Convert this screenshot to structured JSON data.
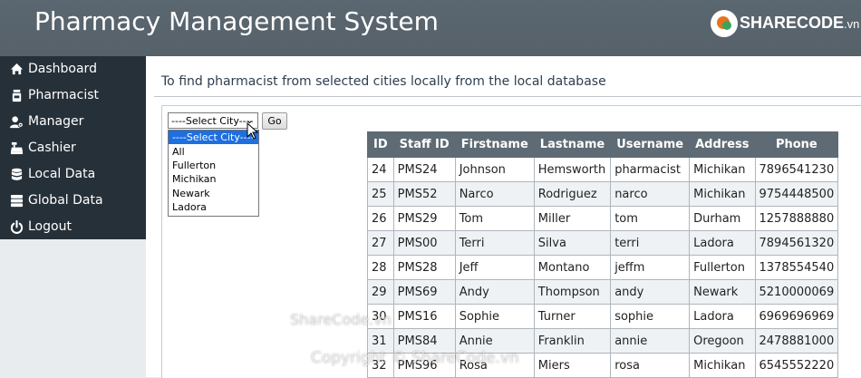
{
  "header": {
    "title": "Pharmacy Management System",
    "brand": {
      "name": "SHARECODE",
      "domain": ".vn"
    }
  },
  "sidebar": {
    "items": [
      {
        "label": "Dashboard",
        "icon": "home-icon"
      },
      {
        "label": "Pharmacist",
        "icon": "pill-bottle-icon"
      },
      {
        "label": "Manager",
        "icon": "user-gear-icon"
      },
      {
        "label": "Cashier",
        "icon": "cash-register-icon"
      },
      {
        "label": "Local Data",
        "icon": "database-icon"
      },
      {
        "label": "Global Data",
        "icon": "server-icon"
      },
      {
        "label": "Logout",
        "icon": "power-icon"
      }
    ]
  },
  "main": {
    "description": "To find pharmacist from selected cities locally from the local database",
    "city_select": {
      "value": "----Select City----",
      "options": [
        "----Select City----",
        "All",
        "Fullerton",
        "Michikan",
        "Newark",
        "Ladora"
      ],
      "selected_index": 0
    },
    "go_label": "Go"
  },
  "table": {
    "columns": [
      "ID",
      "Staff ID",
      "Firstname",
      "Lastname",
      "Username",
      "Address",
      "Phone"
    ],
    "rows": [
      [
        "24",
        "PMS24",
        "Johnson",
        "Hemsworth",
        "pharmacist",
        "Michikan",
        "7896541230"
      ],
      [
        "25",
        "PMS52",
        "Narco",
        "Rodriguez",
        "narco",
        "Michikan",
        "9754448500"
      ],
      [
        "26",
        "PMS29",
        "Tom",
        "Miller",
        "tom",
        "Durham",
        "1257888880"
      ],
      [
        "27",
        "PMS00",
        "Terri",
        "Silva",
        "terri",
        "Ladora",
        "7894561320"
      ],
      [
        "28",
        "PMS28",
        "Jeff",
        "Montano",
        "jeffm",
        "Fullerton",
        "1378554540"
      ],
      [
        "29",
        "PMS69",
        "Andy",
        "Thompson",
        "andy",
        "Newark",
        "5210000069"
      ],
      [
        "30",
        "PMS16",
        "Sophie",
        "Turner",
        "sophie",
        "Ladora",
        "6969696969"
      ],
      [
        "31",
        "PMS84",
        "Annie",
        "Franklin",
        "annie",
        "Oregoon",
        "2478881000"
      ],
      [
        "32",
        "PMS96",
        "Rosa",
        "Miers",
        "rosa",
        "Michikan",
        "6545552220"
      ]
    ]
  },
  "watermark": {
    "line1": "ShareCode.vn",
    "line2": "Copyright © ShareCode.vn"
  },
  "colors": {
    "header_bg": "#5b6770",
    "sidebar_bg": "#263038",
    "table_header_bg": "#5e6b74",
    "selected_option_bg": "#1e6fe0"
  }
}
